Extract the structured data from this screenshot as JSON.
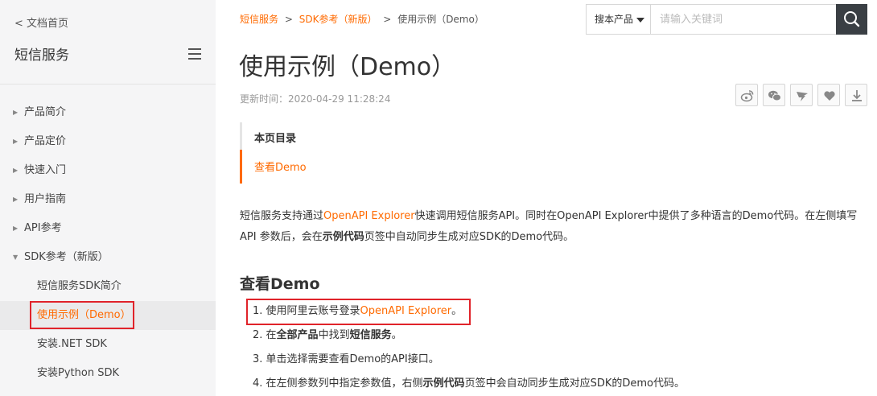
{
  "sidebar": {
    "back_label": "< 文档首页",
    "title": "短信服务",
    "items": [
      {
        "label": "产品简介"
      },
      {
        "label": "产品定价"
      },
      {
        "label": "快速入门"
      },
      {
        "label": "用户指南"
      },
      {
        "label": "API参考"
      },
      {
        "label": "SDK参考（新版）"
      }
    ],
    "sub_items": [
      {
        "label": "短信服务SDK简介"
      },
      {
        "label": "使用示例（Demo）"
      },
      {
        "label": "安装.NET SDK"
      },
      {
        "label": "安装Python SDK"
      }
    ]
  },
  "breadcrumb": {
    "items": [
      "短信服务",
      "SDK参考（新版）",
      "使用示例（Demo）"
    ],
    "separator": ">"
  },
  "search": {
    "scope_label": "搜本产品",
    "placeholder": "请输入关键词"
  },
  "page": {
    "title": "使用示例（Demo）",
    "updated": "更新时间：2020-04-29 11:28:24"
  },
  "share_icons": [
    "weibo-icon",
    "wechat-icon",
    "dingtalk-icon",
    "like-icon",
    "download-icon"
  ],
  "toc": {
    "title": "本页目录",
    "items": [
      "查看Demo"
    ]
  },
  "intro": {
    "p1": "短信服务支持通过",
    "link": "OpenAPI Explorer",
    "p2": "快速调用短信服务API。同时在OpenAPI Explorer中提供了多种语言的Demo代码。在左侧填写API 参数后，会在",
    "bold": "示例代码",
    "p3": "页签中自动同步生成对应SDK的Demo代码。"
  },
  "section": {
    "title": "查看Demo",
    "steps": [
      {
        "a": "1. 使用阿里云账号登录",
        "link": "OpenAPI Explorer",
        "b": "。"
      },
      {
        "a": "2. 在",
        "b1": "全部产品",
        "c": "中找到",
        "b2": "短信服务",
        "d": "。"
      },
      {
        "a": "3. 单击选择需要查看Demo的API接口。"
      },
      {
        "a": "4. 在左侧参数列中指定参数值，右侧",
        "b1": "示例代码",
        "c": "页签中会自动同步生成对应SDK的Demo代码。"
      }
    ]
  },
  "colors": {
    "accent": "#ff6a00",
    "highlight_border": "#e0232a",
    "sidebar_bg": "#f5f5f6",
    "search_button": "#3a3f44"
  }
}
